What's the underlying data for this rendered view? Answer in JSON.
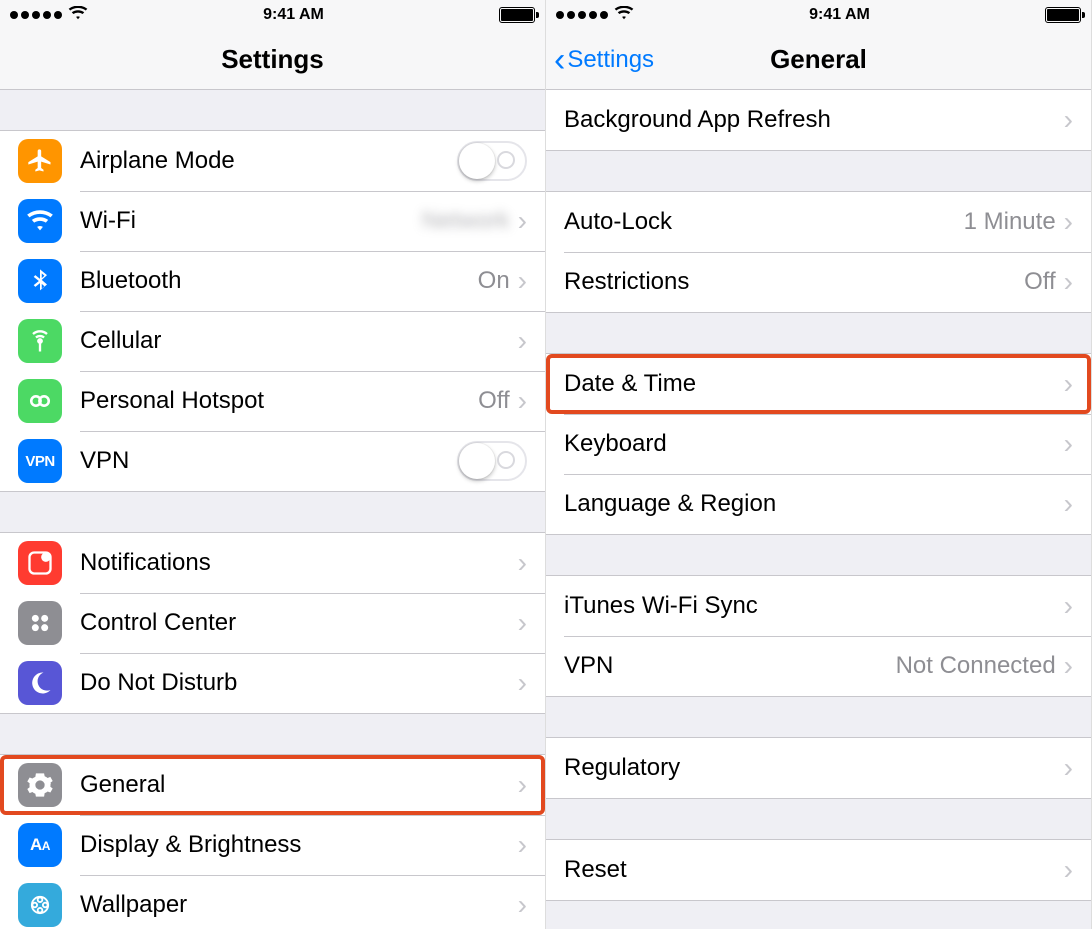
{
  "status": {
    "time": "9:41 AM"
  },
  "left": {
    "nav_title": "Settings",
    "groups": [
      {
        "rows": [
          {
            "id": "airplane",
            "icon": "airplane-icon",
            "label": "Airplane Mode",
            "type": "toggle"
          },
          {
            "id": "wifi",
            "icon": "wifi-icon",
            "label": "Wi-Fi",
            "type": "disclose",
            "detail": "Network",
            "detail_blurred": true
          },
          {
            "id": "bluetooth",
            "icon": "bluetooth-icon",
            "label": "Bluetooth",
            "type": "disclose",
            "detail": "On"
          },
          {
            "id": "cellular",
            "icon": "cellular-icon",
            "label": "Cellular",
            "type": "disclose"
          },
          {
            "id": "hotspot",
            "icon": "hotspot-icon",
            "label": "Personal Hotspot",
            "type": "disclose",
            "detail": "Off"
          },
          {
            "id": "vpn",
            "icon": "vpn-icon",
            "label": "VPN",
            "type": "toggle"
          }
        ]
      },
      {
        "rows": [
          {
            "id": "notifications",
            "icon": "notifications-icon",
            "label": "Notifications",
            "type": "disclose"
          },
          {
            "id": "controlcenter",
            "icon": "controlcenter-icon",
            "label": "Control Center",
            "type": "disclose"
          },
          {
            "id": "dnd",
            "icon": "dnd-icon",
            "label": "Do Not Disturb",
            "type": "disclose"
          }
        ]
      },
      {
        "rows": [
          {
            "id": "general",
            "icon": "general-icon",
            "label": "General",
            "type": "disclose",
            "highlight": true
          },
          {
            "id": "display",
            "icon": "display-icon",
            "label": "Display & Brightness",
            "type": "disclose"
          },
          {
            "id": "wallpaper",
            "icon": "wallpaper-icon",
            "label": "Wallpaper",
            "type": "disclose"
          }
        ]
      }
    ]
  },
  "right": {
    "nav_title": "General",
    "back_label": "Settings",
    "groups": [
      {
        "rows": [
          {
            "id": "bgrefresh",
            "label": "Background App Refresh",
            "type": "disclose"
          }
        ]
      },
      {
        "rows": [
          {
            "id": "autolock",
            "label": "Auto-Lock",
            "type": "disclose",
            "detail": "1 Minute"
          },
          {
            "id": "restrictions",
            "label": "Restrictions",
            "type": "disclose",
            "detail": "Off"
          }
        ]
      },
      {
        "rows": [
          {
            "id": "datetime",
            "label": "Date & Time",
            "type": "disclose",
            "highlight": true
          },
          {
            "id": "keyboard",
            "label": "Keyboard",
            "type": "disclose"
          },
          {
            "id": "langreg",
            "label": "Language & Region",
            "type": "disclose"
          }
        ]
      },
      {
        "rows": [
          {
            "id": "itunessync",
            "label": "iTunes Wi-Fi Sync",
            "type": "disclose"
          },
          {
            "id": "vpn2",
            "label": "VPN",
            "type": "disclose",
            "detail": "Not Connected"
          }
        ]
      },
      {
        "rows": [
          {
            "id": "regulatory",
            "label": "Regulatory",
            "type": "disclose"
          }
        ]
      },
      {
        "rows": [
          {
            "id": "reset",
            "label": "Reset",
            "type": "disclose"
          }
        ]
      }
    ]
  }
}
